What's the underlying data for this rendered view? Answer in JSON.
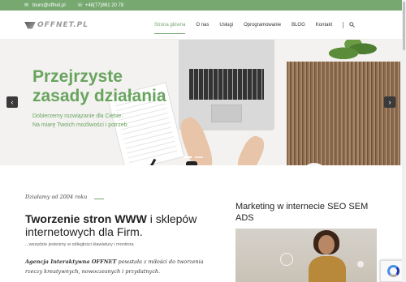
{
  "topbar": {
    "email": "biuro@offnet.pl",
    "phone": "+48(77)861 20 78",
    "email_icon": "envelope-icon",
    "phone_icon": "phone-icon"
  },
  "header": {
    "logo_text": "OFFNET.PL",
    "nav": [
      {
        "label": "Strona główna",
        "active": true
      },
      {
        "label": "O nas"
      },
      {
        "label": "Usługi"
      },
      {
        "label": "Oprogramowanie"
      },
      {
        "label": "BLOG"
      },
      {
        "label": "Kontakt"
      }
    ],
    "search_icon": "search-icon"
  },
  "hero": {
    "title_line1": "Przejrzyste",
    "title_line2": "zasady działania",
    "subtitle_line1": "Dobierzemy rozwiązanie dla Ciebie.",
    "subtitle_line2": "Na miarę Twoich możliwości i potrzeb.",
    "prev_label": "‹",
    "next_label": "›"
  },
  "intro": {
    "since": "Działamy od 2004 roku",
    "title_bold": "Tworzenie stron WWW",
    "title_rest": " i sklepów internetowych dla Firm.",
    "tagline": "...wszędzie jesteśmy w odległości klawiatury i monitora",
    "desc_bold": "Agencja Interaktywna OFFNET",
    "desc_rest": " powstała z miłości do tworzenia rzeczy kreatywnych, nowoczesnych i przydatnych."
  },
  "sidebar": {
    "heading": "Marketing w internecie SEO SEM ADS"
  },
  "colors": {
    "accent": "#76a870",
    "hero_text": "#69a45f"
  }
}
